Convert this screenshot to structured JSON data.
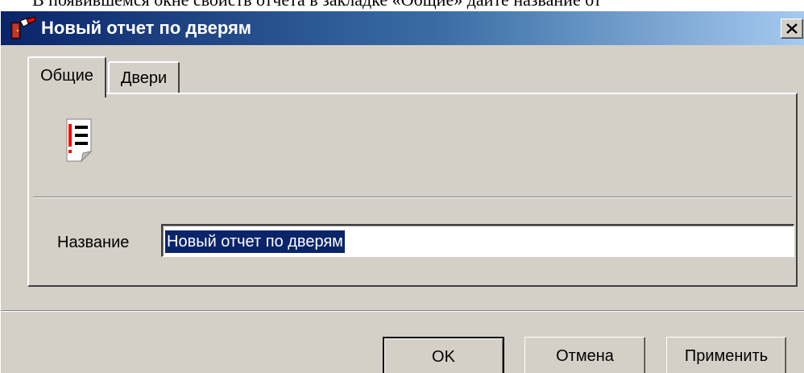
{
  "document": {
    "text": "В появившемся окне свойств отчета в закладке «Общие» дайте название от"
  },
  "window": {
    "title": "Новый отчет по дверям",
    "icons": {
      "app": "door-report-app-icon",
      "close": "close-icon",
      "report": "report-list-icon"
    }
  },
  "tabs": [
    {
      "label": "Общие",
      "selected": true
    },
    {
      "label": "Двери",
      "selected": false
    }
  ],
  "form": {
    "name_label": "Название",
    "name_value": "Новый отчет по дверям"
  },
  "buttons": {
    "ok": "OK",
    "cancel": "Отмена",
    "apply": "Применить"
  },
  "colors": {
    "titlebar_start": "#0a246a",
    "titlebar_end": "#a6caf0",
    "face": "#d4d0c8",
    "selection": "#0a246a",
    "report_icon_accent": "#ff0000"
  }
}
